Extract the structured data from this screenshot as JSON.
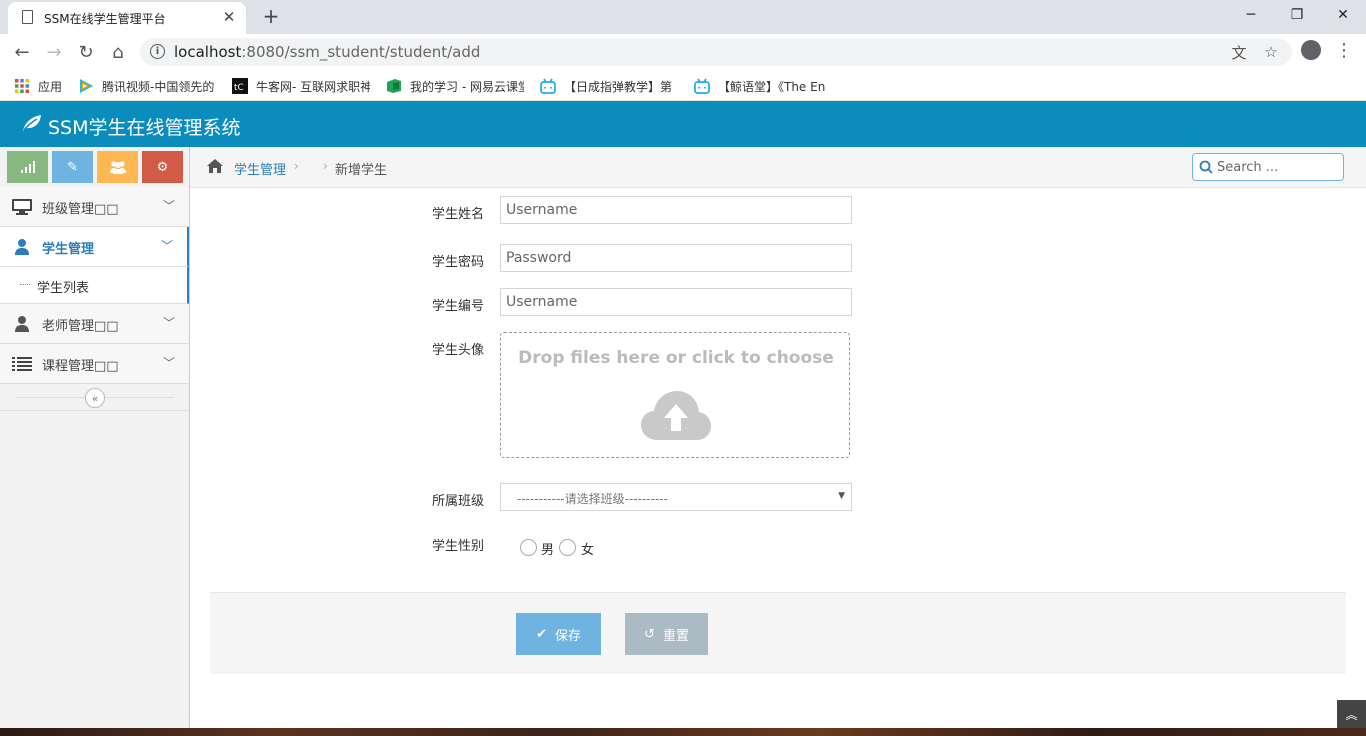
{
  "browser": {
    "tab_title": "SSM在线学生管理平台",
    "url_host": "localhost",
    "url_rest": ":8080/ssm_student/student/add",
    "bookmarks": [
      {
        "label": "应用",
        "icon": "apps-grid-icon"
      },
      {
        "label": "腾讯视频-中国领先的",
        "icon": "tencent-video-icon"
      },
      {
        "label": "牛客网- 互联网求职神",
        "icon": "nowcoder-icon"
      },
      {
        "label": "我的学习 - 网易云课堂",
        "icon": "netease-study-icon"
      },
      {
        "label": "【日成指弹教学】第",
        "icon": "bilibili-icon"
      },
      {
        "label": "【鲸语堂】《The En",
        "icon": "bilibili-icon"
      }
    ]
  },
  "app": {
    "brand": "SSM学生在线管理系统",
    "header_color": "#0a8cbd"
  },
  "sidebar": {
    "shortcuts": [
      {
        "icon": "signal-icon",
        "color": "#87b87f"
      },
      {
        "icon": "pencil-icon",
        "color": "#6fb3e0"
      },
      {
        "icon": "users-icon",
        "color": "#ffb752"
      },
      {
        "icon": "cogs-icon",
        "color": "#d15b47"
      }
    ],
    "items": [
      {
        "label": "班级管理□□",
        "icon": "desktop-icon"
      },
      {
        "label": "学生管理",
        "icon": "user-icon",
        "active": true
      },
      {
        "label": "老师管理□□",
        "icon": "user-icon"
      },
      {
        "label": "课程管理□□",
        "icon": "list-icon"
      }
    ],
    "subitem": "学生列表"
  },
  "breadcrumb": {
    "parent": "学生管理",
    "current": "新增学生"
  },
  "search": {
    "placeholder": "Search ..."
  },
  "form": {
    "name_label": "学生姓名",
    "name_placeholder": "Username",
    "password_label": "学生密码",
    "password_placeholder": "Password",
    "number_label": "学生编号",
    "number_placeholder": "Username",
    "avatar_label": "学生头像",
    "dropzone_text": "Drop files here or click to choose",
    "class_label": "所属班级",
    "class_selected": "-----------请选择班级----------",
    "gender_label": "学生性别",
    "gender_options": [
      "男",
      "女"
    ]
  },
  "actions": {
    "save": "保存",
    "reset": "重置"
  }
}
